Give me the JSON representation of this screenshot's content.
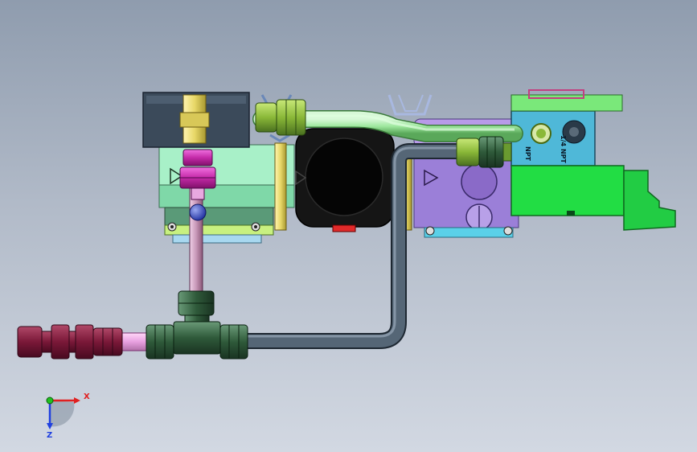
{
  "scene": {
    "colors": {
      "background_top": "#8f9cae",
      "background_bottom": "#d2d8e2",
      "solenoid_block": "#3b4a5a",
      "valve_body_green": "#9ee8b8",
      "valve_body_purple": "#9b7fd8",
      "manifold_cyan": "#4fb8d8",
      "bracket_green": "#22dd44",
      "pump_black": "#111111",
      "tube_green": "#a8e8a8",
      "tube_dark": "#4a5a6a",
      "tube_pink": "#d8a8c8",
      "fitting_dark_green": "#2f5a3a",
      "fitting_magenta": "#c42aa8",
      "fitting_maroon": "#7a1838"
    },
    "labels": {
      "port_label_upper": "1/4 NPT",
      "port_label_lower": "NPT"
    }
  },
  "triad": {
    "x_label": "X",
    "z_label": "Z",
    "x_color": "#e02020",
    "y_color": "#20c020",
    "z_color": "#2040e0"
  }
}
